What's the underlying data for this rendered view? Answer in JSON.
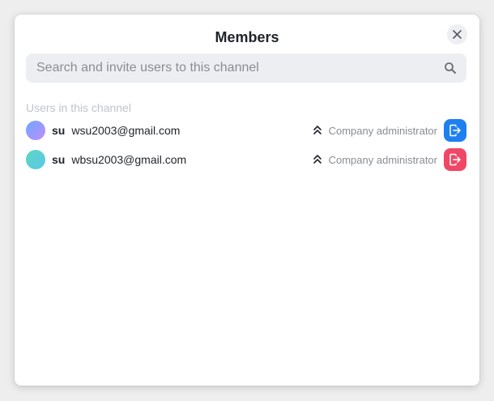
{
  "dialog": {
    "title": "Members",
    "close_icon": "close-icon"
  },
  "search": {
    "placeholder": "Search and invite users to this channel",
    "value": "",
    "icon": "search-icon"
  },
  "section": {
    "label": "Users in this channel"
  },
  "members": [
    {
      "name": "su",
      "email": "wsu2003@gmail.com",
      "role": "Company administrator",
      "role_icon": "double-chevron-up-icon",
      "avatar_gradient": [
        "#6ea8ff",
        "#c08cff"
      ],
      "action_icon": "leave-icon",
      "action_color": "#1f7ff0"
    },
    {
      "name": "su",
      "email": "wbsu2003@gmail.com",
      "role": "Company administrator",
      "role_icon": "double-chevron-up-icon",
      "avatar_gradient": [
        "#5fd6c4",
        "#58c8e8"
      ],
      "action_icon": "leave-icon",
      "action_color": "#f04766"
    }
  ],
  "colors": {
    "background": "#eeeeef",
    "panel": "#ffffff",
    "search_bg": "#eceef2",
    "muted_text": "#8a8d93",
    "section_text": "#bfc3cc"
  }
}
